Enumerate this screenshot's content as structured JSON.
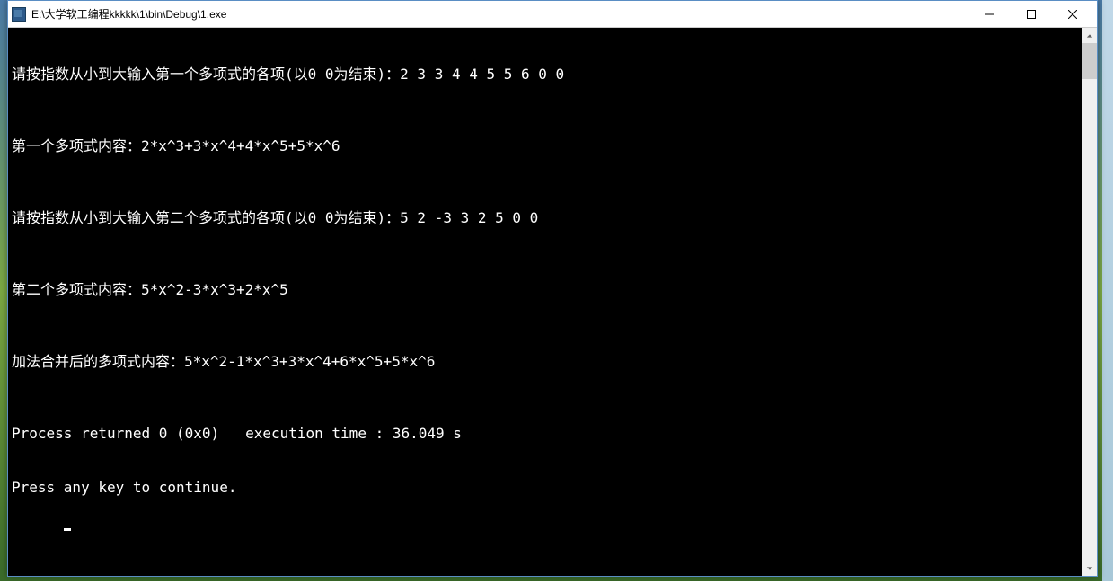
{
  "titlebar": {
    "title": "E:\\大学软工编程kkkkk\\1\\bin\\Debug\\1.exe"
  },
  "console": {
    "lines": [
      "请按指数从小到大输入第一个多项式的各项(以0 0为结束)：2 3 3 4 4 5 5 6 0 0",
      "",
      "第一个多项式内容：2*x^3+3*x^4+4*x^5+5*x^6",
      "",
      "请按指数从小到大输入第二个多项式的各项(以0 0为结束)：5 2 -3 3 2 5 0 0",
      "",
      "第二个多项式内容：5*x^2-3*x^3+2*x^5",
      "",
      "加法合并后的多项式内容：5*x^2-1*x^3+3*x^4+6*x^5+5*x^6",
      "",
      "Process returned 0 (0x0)   execution time : 36.049 s",
      "Press any key to continue."
    ]
  }
}
